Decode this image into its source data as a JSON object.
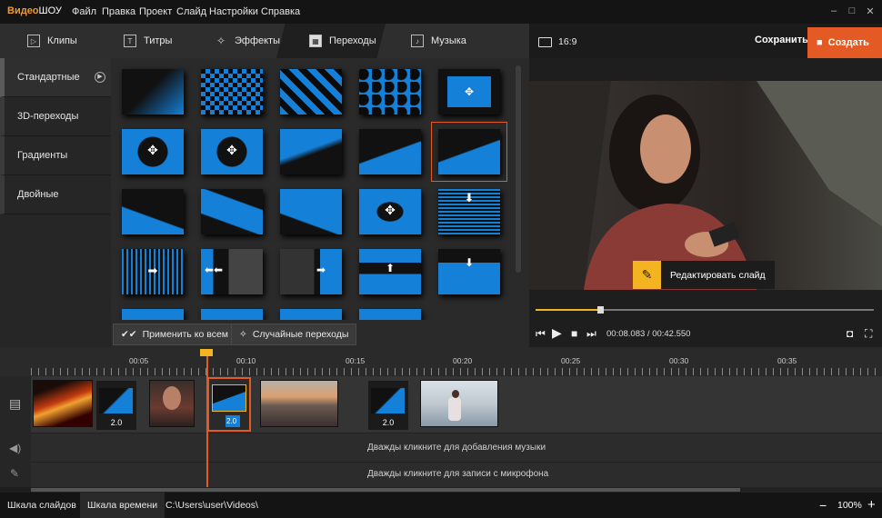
{
  "app": {
    "logo_prefix": "Видео",
    "logo_suffix": "ШОУ"
  },
  "menu": [
    "Файл",
    "Правка",
    "Проект",
    "Слайд",
    "Настройки",
    "Справка"
  ],
  "window": {
    "minimize": "–",
    "maximize": "□",
    "close": "✕"
  },
  "tabs": [
    {
      "label": "Клипы",
      "icon": "film-icon"
    },
    {
      "label": "Титры",
      "icon": "text-icon"
    },
    {
      "label": "Эффекты",
      "icon": "magic-wand-icon"
    },
    {
      "label": "Переходы",
      "icon": "clapper-icon",
      "active": true
    },
    {
      "label": "Музыка",
      "icon": "music-icon"
    }
  ],
  "categories": [
    "Стандартные",
    "3D-переходы",
    "Градиенты",
    "Двойные"
  ],
  "grid_buttons": {
    "apply_all": "Применить ко всем",
    "random": "Случайные переходы"
  },
  "preview": {
    "aspect": "16:9",
    "save": "Сохранить",
    "create": "Создать",
    "edit_slide": "Редактировать слайд"
  },
  "player": {
    "current_time": "00:08.083",
    "separator": " / ",
    "total_time": "00:42.550",
    "progress": 0.19
  },
  "timeline": {
    "ticks": [
      "00:05",
      "00:10",
      "00:15",
      "00:20",
      "00:25",
      "00:30",
      "00:35"
    ],
    "transition_durations": [
      "2.0",
      "2.0",
      "2.0"
    ],
    "music_hint": "Дважды кликните для добавления музыки",
    "mic_hint": "Дважды кликните для записи с микрофона"
  },
  "status": {
    "tab_slides": "Шкала слайдов",
    "tab_timeline": "Шкала времени",
    "path": "C:\\Users\\user\\Videos\\",
    "zoom": "100%",
    "zoom_out": "−",
    "zoom_in": "+"
  },
  "colors": {
    "accent": "#e45a24",
    "highlight": "#f4b321",
    "transition_blue": "#1480d8"
  }
}
